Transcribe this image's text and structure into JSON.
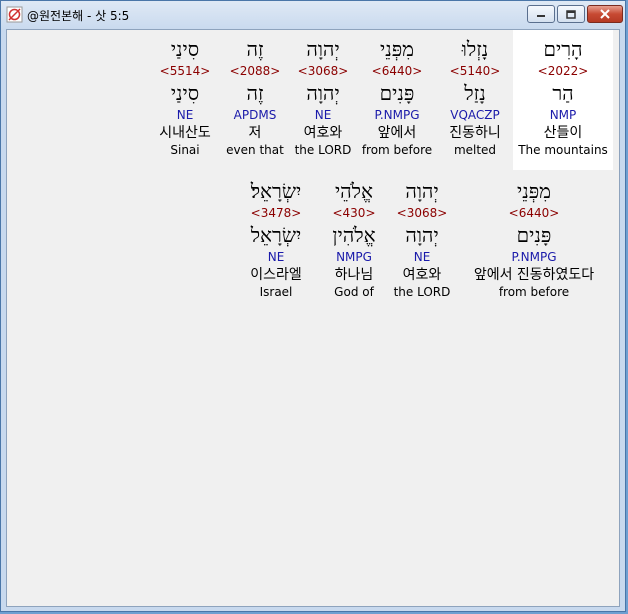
{
  "window": {
    "title": "@원전본해 - 삿 5:5",
    "icons": {
      "app": "bible-app-icon",
      "minimize": "minimize-icon",
      "maximize": "maximize-icon",
      "close": "close-icon"
    }
  },
  "rows": [
    {
      "words": [
        {
          "hebrew": "הָרִים",
          "strongs": "<2022>",
          "lemma": "הַר",
          "parse": "NMP",
          "korean": "산들이",
          "english": "The mountains",
          "selected": true
        },
        {
          "hebrew": "נָזְלוּ",
          "strongs": "<5140>",
          "lemma": "נָזַל",
          "parse": "VQACZP",
          "korean": "진동하니",
          "english": "melted",
          "selected": false
        },
        {
          "hebrew": "מִפְּנֵי",
          "strongs": "<6440>",
          "lemma": "פָּנִים",
          "parse": "P.NMPG",
          "korean": "앞에서",
          "english": "from before",
          "selected": false
        },
        {
          "hebrew": "יְהוָה",
          "strongs": "<3068>",
          "lemma": "יְהוָה",
          "parse": "NE",
          "korean": "여호와",
          "english": "the LORD",
          "selected": false
        },
        {
          "hebrew": "זֶה",
          "strongs": "<2088>",
          "lemma": "זֶה",
          "parse": "APDMS",
          "korean": "저",
          "english": "even that",
          "selected": false
        },
        {
          "hebrew": "סִינַי",
          "strongs": "<5514>",
          "lemma": "סִינַי",
          "parse": "NE",
          "korean": "시내산도",
          "english": "Sinai",
          "selected": false
        }
      ]
    },
    {
      "words": [
        {
          "hebrew": "מִפְּנֵי",
          "strongs": "<6440>",
          "lemma": "פָּנִים",
          "parse": "P.NMPG",
          "korean": "앞에서 진동하였도다",
          "english": "from before",
          "selected": false
        },
        {
          "hebrew": "יְהוָה",
          "strongs": "<3068>",
          "lemma": "יְהוָה",
          "parse": "NE",
          "korean": "여호와",
          "english": "the LORD",
          "selected": false
        },
        {
          "hebrew": "אֱלֹהֵי",
          "strongs": "<430>",
          "lemma": "אֱלֹהִין",
          "parse": "NMPG",
          "korean": "하나님",
          "english": "God of",
          "selected": false
        },
        {
          "hebrew": "יִשְׂרָאֵל׃",
          "strongs": "<3478>",
          "lemma": "יִשְׂרָאֵל",
          "parse": "NE",
          "korean": "이스라엘",
          "english": "Israel",
          "selected": false
        }
      ]
    }
  ]
}
